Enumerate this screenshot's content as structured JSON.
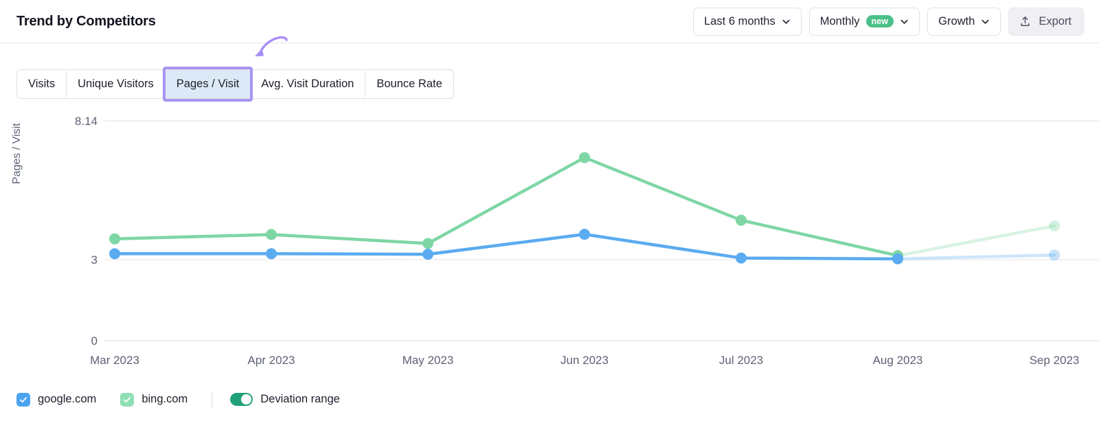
{
  "header": {
    "title": "Trend by Competitors",
    "controls": [
      {
        "label": "Last 6 months",
        "icon": "chevron-down-icon",
        "badge": null
      },
      {
        "label": "Monthly",
        "icon": "chevron-down-icon",
        "badge": "new"
      },
      {
        "label": "Growth",
        "icon": "chevron-down-icon",
        "badge": null
      },
      {
        "label": "Export",
        "icon": "upload-icon",
        "badge": null
      }
    ]
  },
  "tabs": [
    {
      "label": "Visits",
      "selected": false
    },
    {
      "label": "Unique Visitors",
      "selected": false
    },
    {
      "label": "Pages / Visit",
      "selected": true
    },
    {
      "label": "Avg. Visit Duration",
      "selected": false
    },
    {
      "label": "Bounce Rate",
      "selected": false
    }
  ],
  "annotation": {
    "type": "curved-arrow",
    "color": "#a78bfa",
    "points_to": "Pages / Visit"
  },
  "legend": {
    "items": [
      {
        "label": "google.com",
        "color": "#4ba3ef",
        "checked": true
      },
      {
        "label": "bing.com",
        "color": "#8fdfb4",
        "checked": true
      }
    ],
    "toggle": {
      "label": "Deviation range",
      "on": true,
      "color": "#21a179"
    }
  },
  "chart_data": {
    "type": "line",
    "title": "Trend by Competitors",
    "xlabel": "",
    "ylabel": "Pages / Visit",
    "x": [
      "Mar 2023",
      "Apr 2023",
      "May 2023",
      "Jun 2023",
      "Jul 2023",
      "Aug 2023",
      "Sep 2023"
    ],
    "ylim": [
      0,
      8.14
    ],
    "yticks": [
      0,
      3,
      8.14
    ],
    "ytick_labels": [
      "0",
      "3",
      "8.14"
    ],
    "grid": true,
    "legend_position": "bottom",
    "series": [
      {
        "name": "bing.com",
        "color": "#7ed6a5",
        "values": [
          3.77,
          3.93,
          3.6,
          6.78,
          4.46,
          3.15,
          4.25
        ],
        "projected_from_index": 5
      },
      {
        "name": "google.com",
        "color": "#5aabf0",
        "values": [
          3.22,
          3.22,
          3.2,
          3.94,
          3.06,
          3.03,
          3.17
        ],
        "projected_from_index": 5
      }
    ],
    "notes": "Final segment (Aug 2023 to Sep 2023) rendered faded to indicate deviation range / projection."
  }
}
